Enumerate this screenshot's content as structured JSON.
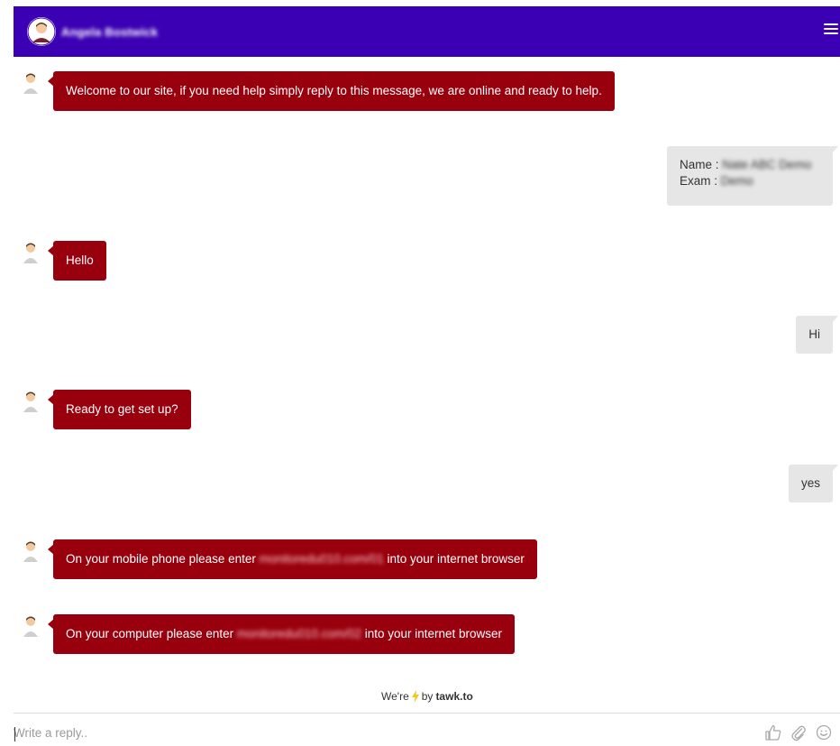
{
  "header": {
    "agent_name": "Angela Bostwick"
  },
  "messages": [
    {
      "sender": "agent",
      "text": "Welcome to our site, if you need help simply reply to this message, we are online and ready to help."
    },
    {
      "sender": "visitor",
      "name_label": "Name :",
      "name_value": "Nate ABC Demo",
      "exam_label": "Exam :",
      "exam_value": "Demo"
    },
    {
      "sender": "agent",
      "text": "Hello"
    },
    {
      "sender": "visitor",
      "text": "Hi"
    },
    {
      "sender": "agent",
      "text": "Ready to get set up?"
    },
    {
      "sender": "visitor",
      "text": "yes"
    },
    {
      "sender": "agent",
      "prefix": "On your mobile phone please enter",
      "link": "monitoredu010.com/01",
      "suffix": "into your internet browser"
    },
    {
      "sender": "agent",
      "prefix": "On your computer  please enter",
      "link": "monitoredu010.com/02",
      "suffix": "into your internet browser"
    }
  ],
  "footer": {
    "powered_prefix": "We're",
    "powered_by": "by",
    "brand": "tawk.to"
  },
  "composer": {
    "placeholder": "Write a reply.."
  },
  "icons": {
    "menu": "hamburger-icon",
    "like": "thumbs-up-icon",
    "attach": "paperclip-icon",
    "emoji": "smiley-icon",
    "lightning": "lightning-icon"
  },
  "colors": {
    "header_bg": "#3b00b3",
    "agent_bubble": "#99000d",
    "visitor_bubble": "#e6e6e6",
    "lightning": "#f5c518"
  }
}
